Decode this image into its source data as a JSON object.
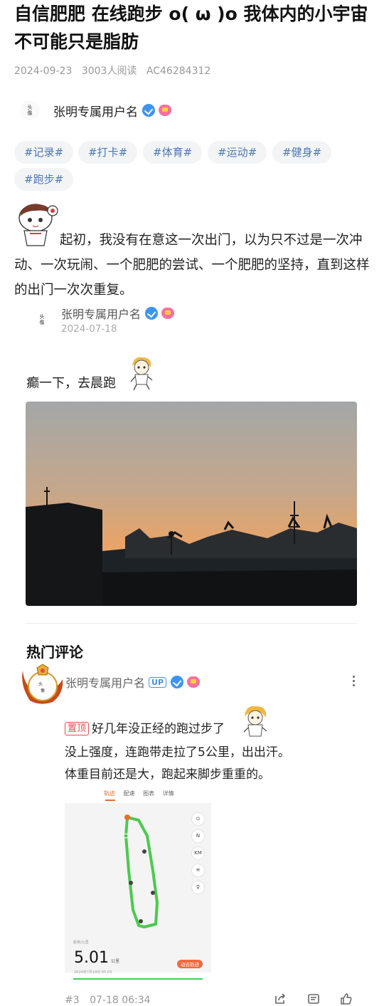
{
  "article": {
    "title": "自信肥肥 在线跑步 o( ω )o 我体内的小宇宙不可能只是脂肪",
    "date": "2024-09-23",
    "reads": "3003人阅读",
    "id": "AC46284312"
  },
  "author": {
    "name": "张明专属用户名",
    "avatar_text": "头像",
    "avatar_chars": [
      "头",
      "像"
    ]
  },
  "tags": [
    "#记录#",
    "#打卡#",
    "#体育#",
    "#运动#",
    "#健身#",
    "#跑步#"
  ],
  "intro": "起初，我没有在意这一次出门，以为只不过是一次冲动、一次玩闹、一个肥肥的尝试、一个肥肥的坚持，直到这样的出门一次次重复。",
  "embedded_post": {
    "author": "张明专属用户名",
    "date": "2024-07-18",
    "text": "癫一下，去晨跑"
  },
  "comments_section": {
    "title": "热门评论",
    "comment": {
      "author": "张明专属用户名",
      "up_badge": "UP",
      "pinned_label": "置顶",
      "lines": [
        "好几年没正经的跑过步了",
        "没上强度，连跑带走拉了5公里，出出汗。",
        "体重目前还是大，跑起来脚步重重的。"
      ],
      "screenshot": {
        "tabs": [
          "轨迹",
          "配速",
          "图表",
          "详情"
        ],
        "map_controls": [
          "⊙",
          "N",
          "KM",
          "≋",
          "♀"
        ],
        "stats_label": "距离/公里",
        "distance": "5.01",
        "distance_unit": "公里",
        "date_label": "2024年7月18日 05:03",
        "dynamic_button": "动态轨迹"
      },
      "floor": "#3",
      "time": "07-18 06:34"
    }
  },
  "colors": {
    "tag_text": "#4a78b6",
    "verified": "#3d94ef",
    "pin": "#e94b4b",
    "route": "#4cc94e"
  }
}
